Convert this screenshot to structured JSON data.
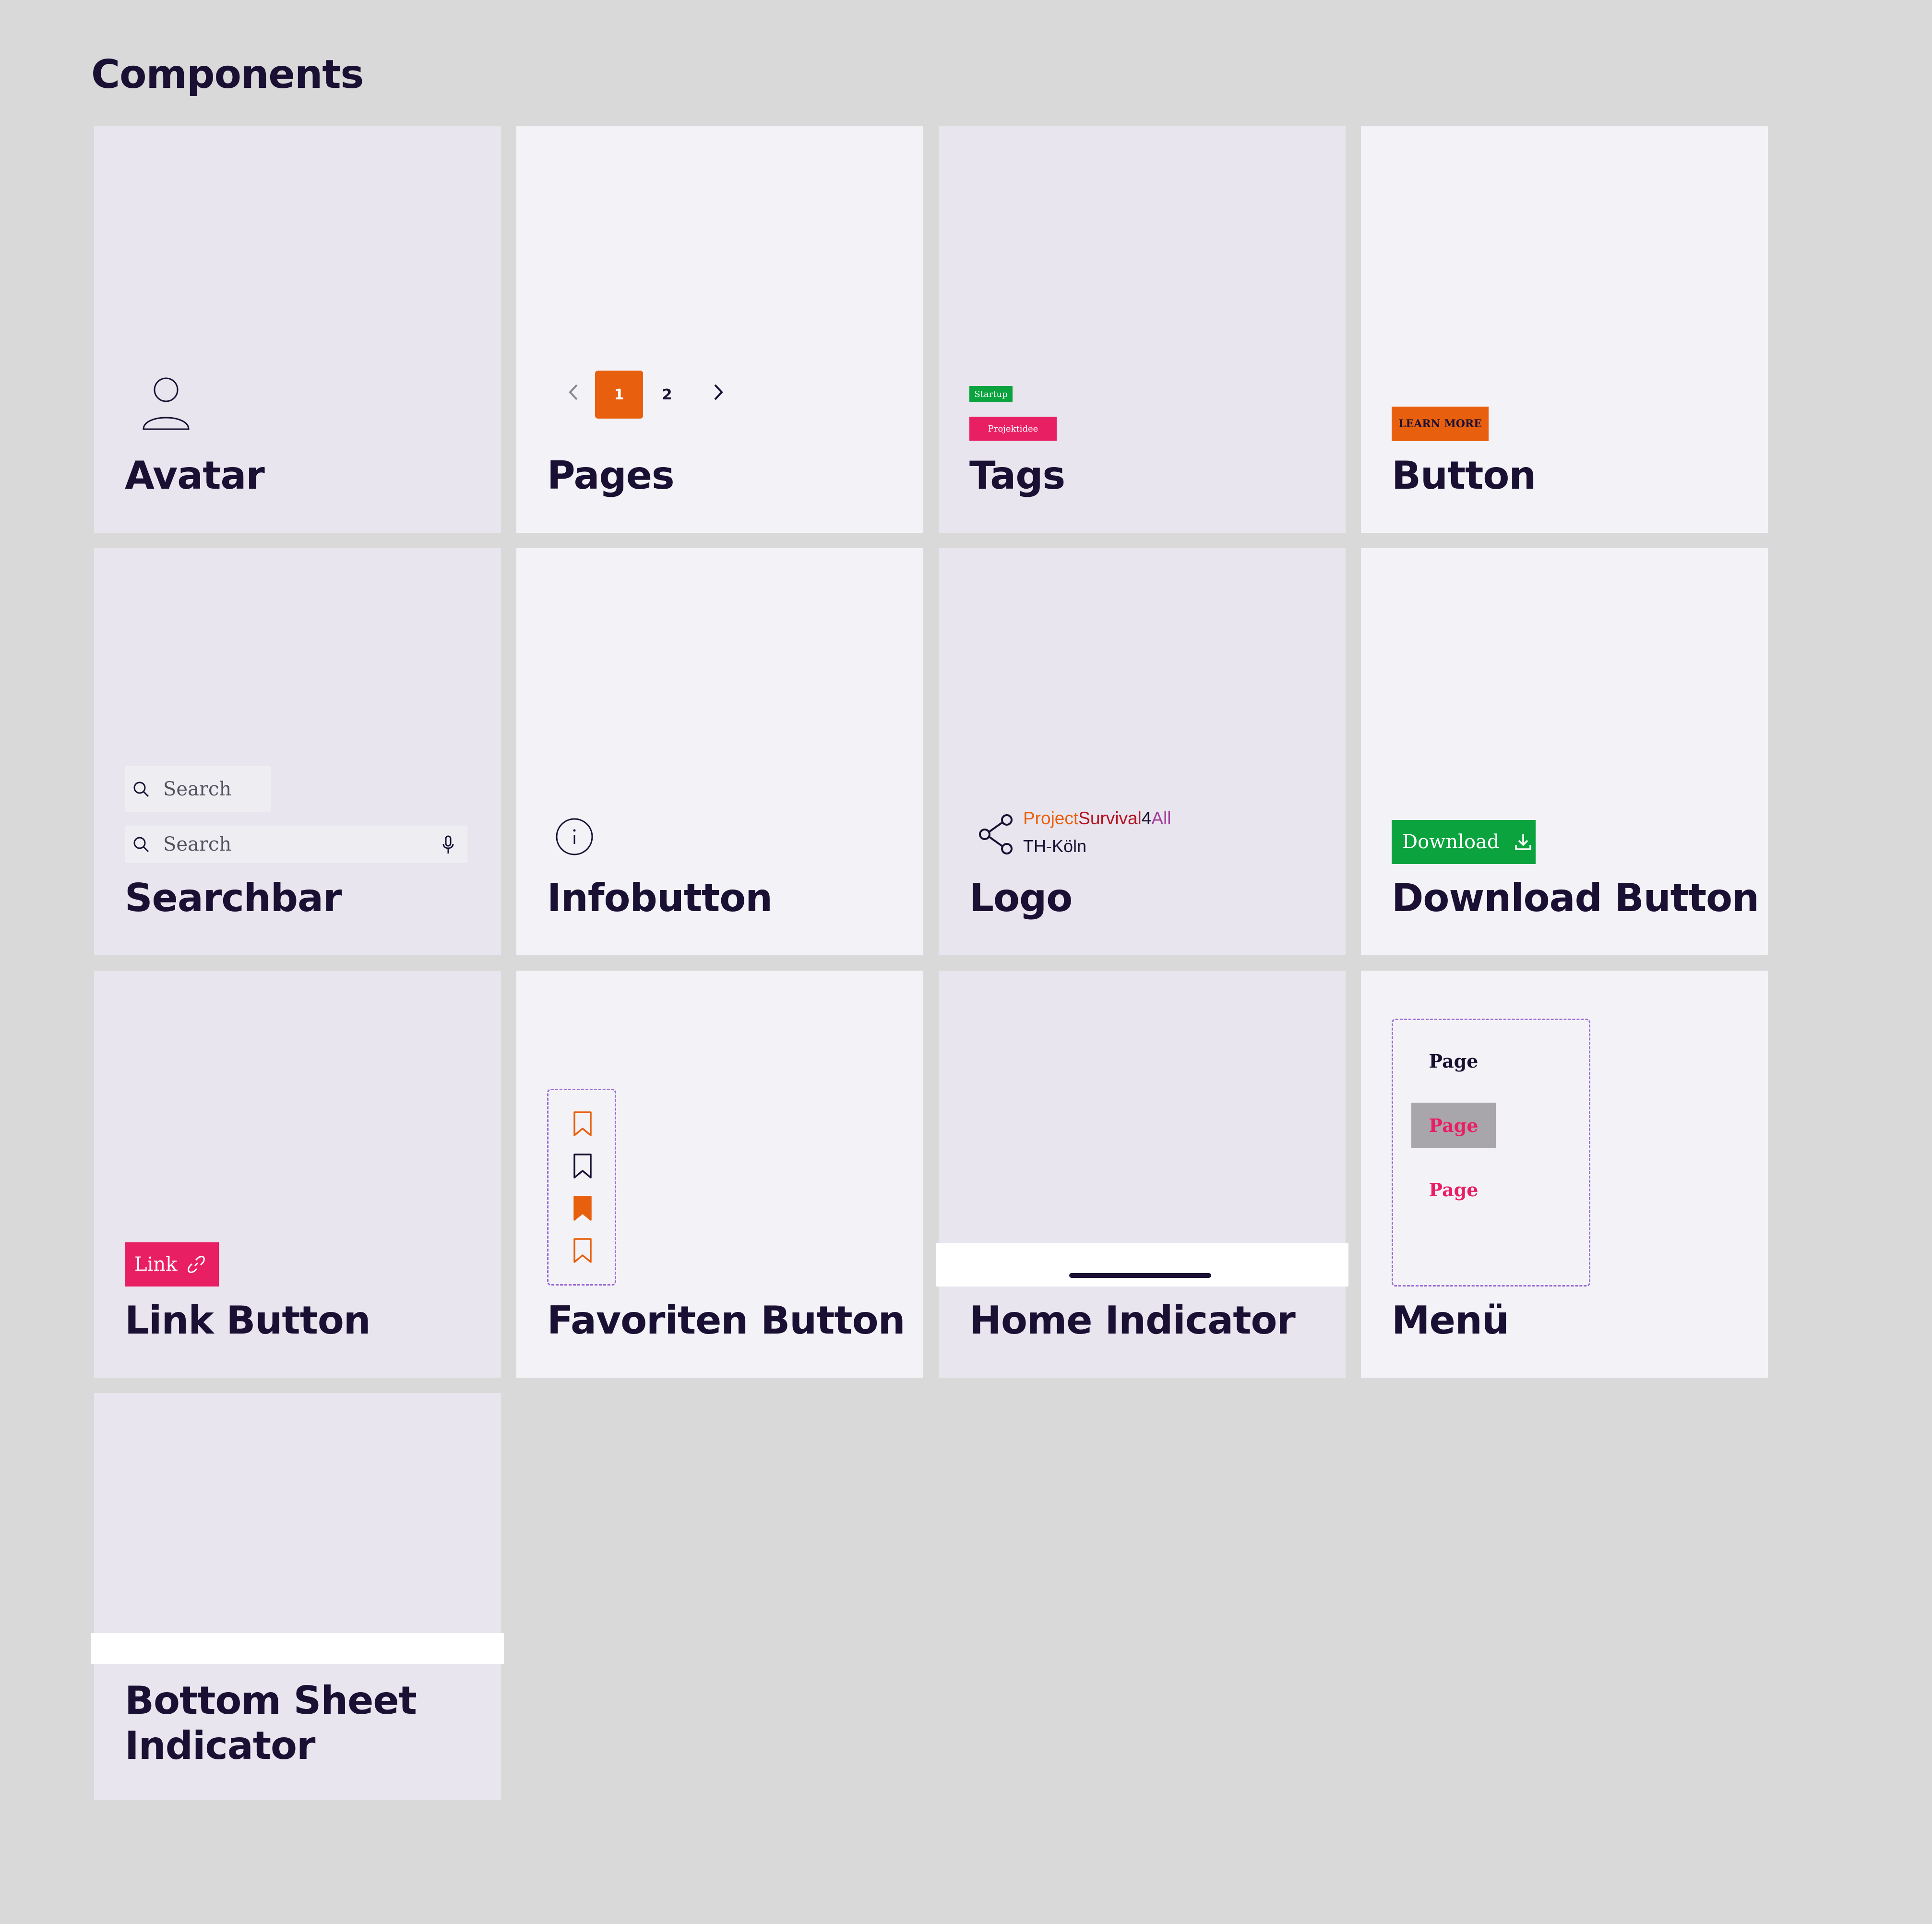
{
  "page": {
    "heading": "Components"
  },
  "colors": {
    "orange": "#e8600e",
    "green": "#0aa33d",
    "pink": "#e91f63",
    "ink": "#1a1033",
    "dashed_frame": "#9b6bd6"
  },
  "cards": {
    "avatar": {
      "title": "Avatar",
      "icon": "user-icon"
    },
    "pages": {
      "title": "Pages",
      "current": "1",
      "next_page": "2",
      "prev_icon": "chevron-left-icon",
      "next_icon": "chevron-right-icon"
    },
    "tags": {
      "title": "Tags",
      "tag_startup": "Startup",
      "tag_projekt": "Projektidee"
    },
    "button": {
      "title": "Button",
      "label": "LEARN MORE"
    },
    "searchbar": {
      "title": "Searchbar",
      "placeholder_1": "Search",
      "placeholder_2": "Search",
      "icon": "search-icon",
      "mic_icon": "microphone-icon"
    },
    "infobutton": {
      "title": "Infobutton",
      "icon": "info-icon"
    },
    "logo": {
      "title": "Logo",
      "part_project": "Project",
      "part_survival": "Survival",
      "part_4": "4",
      "part_all": "All",
      "subtitle": "TH-Köln",
      "icon": "share-icon"
    },
    "download": {
      "title": "Download Button",
      "label": "Download",
      "icon": "download-icon"
    },
    "link": {
      "title": "Link Button",
      "label": "Link",
      "icon": "link-icon"
    },
    "favoriten": {
      "title": "Favoriten Button",
      "icon": "bookmark-icon"
    },
    "home": {
      "title": "Home Indicator"
    },
    "menu": {
      "title": "Menü",
      "items": [
        "Page",
        "Page",
        "Page"
      ]
    },
    "sheet": {
      "title_line1": "Bottom Sheet",
      "title_line2": "Indicator"
    }
  }
}
